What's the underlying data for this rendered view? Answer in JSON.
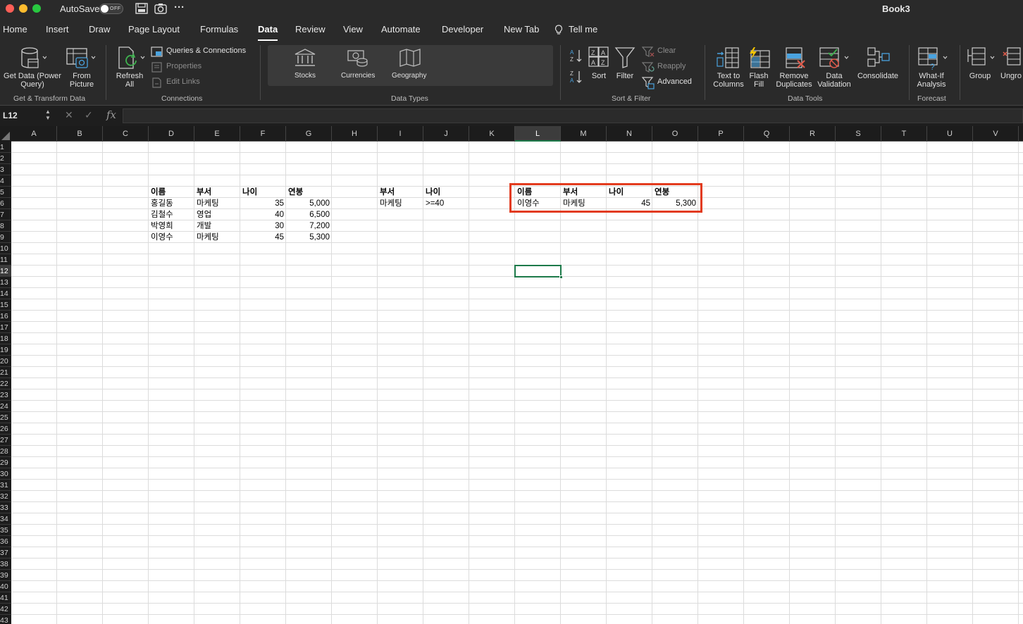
{
  "titlebar": {
    "autosave_label": "AutoSave",
    "autosave_state": "OFF",
    "book_title": "Book3",
    "more_label": "···"
  },
  "tabs": [
    "Home",
    "Insert",
    "Draw",
    "Page Layout",
    "Formulas",
    "Data",
    "Review",
    "View",
    "Automate",
    "Developer",
    "New Tab",
    "Tell me"
  ],
  "active_tab": "Data",
  "ribbon": {
    "get_data": "Get Data (Power\nQuery)",
    "get_data_l1": "Get Data (Power",
    "get_data_l2": "Query)",
    "from_picture_l1": "From",
    "from_picture_l2": "Picture",
    "group_get_transform": "Get & Transform Data",
    "refresh_l1": "Refresh",
    "refresh_l2": "All",
    "queries_connections": "Queries & Connections",
    "properties": "Properties",
    "edit_links": "Edit Links",
    "group_connections": "Connections",
    "stocks": "Stocks",
    "currencies": "Currencies",
    "geography": "Geography",
    "group_data_types": "Data Types",
    "sort": "Sort",
    "filter": "Filter",
    "clear": "Clear",
    "reapply": "Reapply",
    "advanced": "Advanced",
    "group_sort_filter": "Sort & Filter",
    "text_to_columns_l1": "Text to",
    "text_to_columns_l2": "Columns",
    "flash_fill_l1": "Flash",
    "flash_fill_l2": "Fill",
    "remove_duplicates_l1": "Remove",
    "remove_duplicates_l2": "Duplicates",
    "data_validation_l1": "Data",
    "data_validation_l2": "Validation",
    "consolidate": "Consolidate",
    "group_data_tools": "Data Tools",
    "what_if_l1": "What-If",
    "what_if_l2": "Analysis",
    "group_forecast": "Forecast",
    "group": "Group",
    "ungroup": "Ungro"
  },
  "formula_bar": {
    "name_box": "L12",
    "cancel": "✕",
    "enter": "✓",
    "fx": "fx",
    "formula": ""
  },
  "columns": [
    "A",
    "B",
    "C",
    "D",
    "E",
    "F",
    "G",
    "H",
    "I",
    "J",
    "K",
    "L",
    "M",
    "N",
    "O",
    "P",
    "Q",
    "R",
    "S",
    "T",
    "U",
    "V"
  ],
  "selected_column": "L",
  "row_count": 43,
  "selected_row": 12,
  "cells": {
    "D5": "이름",
    "E5": "부서",
    "F5": "나이",
    "G5": "연봉",
    "D6": "홍길동",
    "E6": "마케팅",
    "F6": "35",
    "G6": "5,000",
    "D7": "김철수",
    "E7": "영업",
    "F7": "40",
    "G7": "6,500",
    "D8": "박영희",
    "E8": "개발",
    "F8": "30",
    "G8": "7,200",
    "D9": "이영수",
    "E9": "마케팅",
    "F9": "45",
    "G9": "5,300",
    "I5": "부서",
    "J5": "나이",
    "I6": "마케팅",
    "J6": ">=40",
    "L5": "이름",
    "M5": "부서",
    "N5": "나이",
    "O5": "연봉",
    "L6": "이영수",
    "M6": "마케팅",
    "N6": "45",
    "O6": "5,300"
  },
  "accent_colors": {
    "selection": "#1d7a4a",
    "annotation_box": "#e23b1e"
  }
}
